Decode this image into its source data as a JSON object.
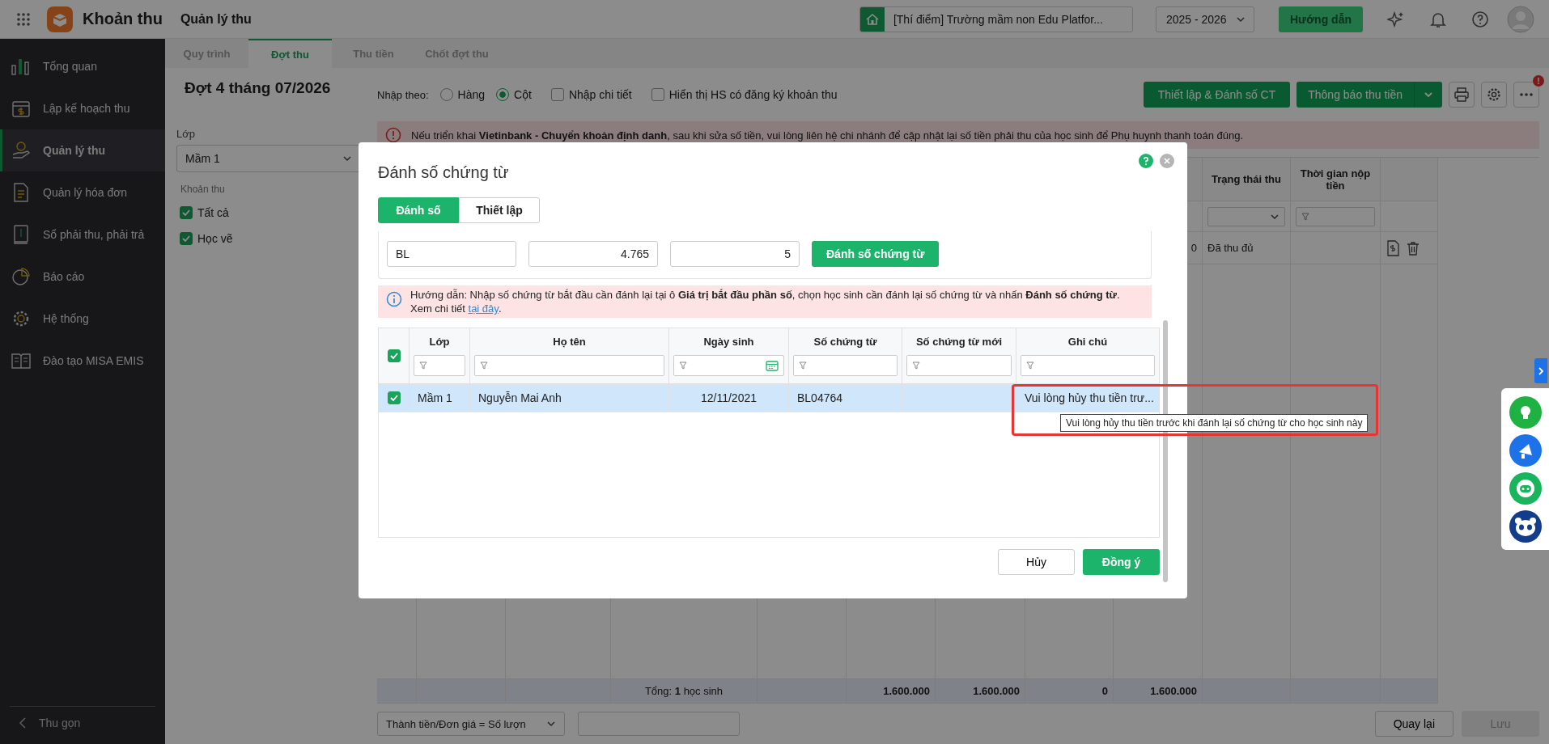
{
  "app": {
    "name": "Khoản thu",
    "module": "Quản lý thu"
  },
  "topbar": {
    "school": "[Thí điểm] Trường mầm non Edu Platfor...",
    "year": "2025 - 2026",
    "guide_button": "Hướng dẫn"
  },
  "sidebar": {
    "items": [
      {
        "label": "Tổng quan",
        "selected": false
      },
      {
        "label": "Lập kế hoạch thu",
        "selected": false
      },
      {
        "label": "Quản lý thu",
        "selected": true
      },
      {
        "label": "Quản lý hóa đơn",
        "selected": false
      },
      {
        "label": "Sổ phải thu, phải trả",
        "selected": false
      },
      {
        "label": "Báo cáo",
        "selected": false
      },
      {
        "label": "Hệ thống",
        "selected": false
      },
      {
        "label": "Đào tạo MISA EMIS",
        "selected": false
      }
    ],
    "collapse": "Thu gọn"
  },
  "page_tabs": [
    {
      "label": "Quy trình",
      "selected": false
    },
    {
      "label": "Đợt thu",
      "selected": true
    },
    {
      "label": "Thu tiền",
      "selected": false
    },
    {
      "label": "Chốt đợt thu",
      "selected": false
    }
  ],
  "batch": {
    "title": "Đợt 4 tháng 07/2026",
    "class_label": "Lớp",
    "class_value": "Mầm 1",
    "fees_label": "Khoản thu",
    "fees": [
      {
        "label": "Tất cả",
        "checked": true
      },
      {
        "label": "Học vẽ",
        "checked": true
      }
    ]
  },
  "toolbar": {
    "input_by_label": "Nhập theo:",
    "radios": [
      {
        "label": "Hàng",
        "selected": false
      },
      {
        "label": "Cột",
        "selected": true
      }
    ],
    "checkboxes": [
      {
        "label": "Nhập chi tiết",
        "checked": false
      },
      {
        "label": "Hiển thị HS có đăng ký khoản thu",
        "checked": false
      }
    ],
    "setup_button": "Thiết lập & Đánh số CT",
    "notify_button": "Thông báo thu tiền",
    "badge": "!"
  },
  "alert": {
    "text": "Nếu triển khai **Vietinbank - Chuyển khoản định danh**, sau khi sửa số tiền, vui lòng liên hệ chi nhánh để cập nhật lại số tiền phải thu của học sinh để Phụ huynh thanh toán đúng."
  },
  "background_table": {
    "columns": [
      "Trạng thái thu",
      "Thời gian nộp tiền"
    ],
    "row": {
      "amount_tail": "0",
      "status": "Đã thu đủ"
    },
    "total_label": "Tổng: **1** học sinh",
    "totals": [
      "1.600.000",
      "1.600.000",
      "0",
      "1.600.000"
    ]
  },
  "footer": {
    "formula": "Thành tiền/Đơn giá = Số lượn",
    "back_button": "Quay lại",
    "save_button": "Lưu",
    "save_disabled": true
  },
  "dialog": {
    "title": "Đánh số chứng từ",
    "tabs": [
      {
        "label": "Đánh số",
        "selected": true
      },
      {
        "label": "Thiết lập",
        "selected": false
      }
    ],
    "prefix": "BL",
    "start_value": "4.765",
    "digits": "5",
    "number_button": "Đánh số chứng từ",
    "hint": "Hướng dẫn: Nhập số chứng từ bắt đầu cần đánh lại tại ô **Giá trị bắt đầu phần số**, chọn học sinh cần đánh lại số chứng từ và nhấn **Đánh số chứng từ**.",
    "hint_more": "Xem chi tiết",
    "hint_link": "tại đây",
    "hint_end": ".",
    "all_checked": true,
    "columns": [
      {
        "label": "Lớp",
        "kind": "text"
      },
      {
        "label": "Họ tên",
        "kind": "text"
      },
      {
        "label": "Ngày sinh",
        "kind": "date"
      },
      {
        "label": "Số chứng từ",
        "kind": "text"
      },
      {
        "label": "Số chứng từ mới",
        "kind": "text"
      },
      {
        "label": "Ghi chú",
        "kind": "text"
      }
    ],
    "rows": [
      {
        "selected": true,
        "checked": true,
        "cells": [
          "Mầm 1",
          "Nguyễn Mai Anh",
          "12/11/2021",
          "BL04764",
          null,
          "Vui lòng hủy thu tiền trư..."
        ]
      }
    ],
    "tooltip": "Vui lòng hủy thu tiền trước khi đánh lại số chứng từ cho học sinh này",
    "cancel_button": "Hủy",
    "ok_button": "Đồng ý"
  }
}
